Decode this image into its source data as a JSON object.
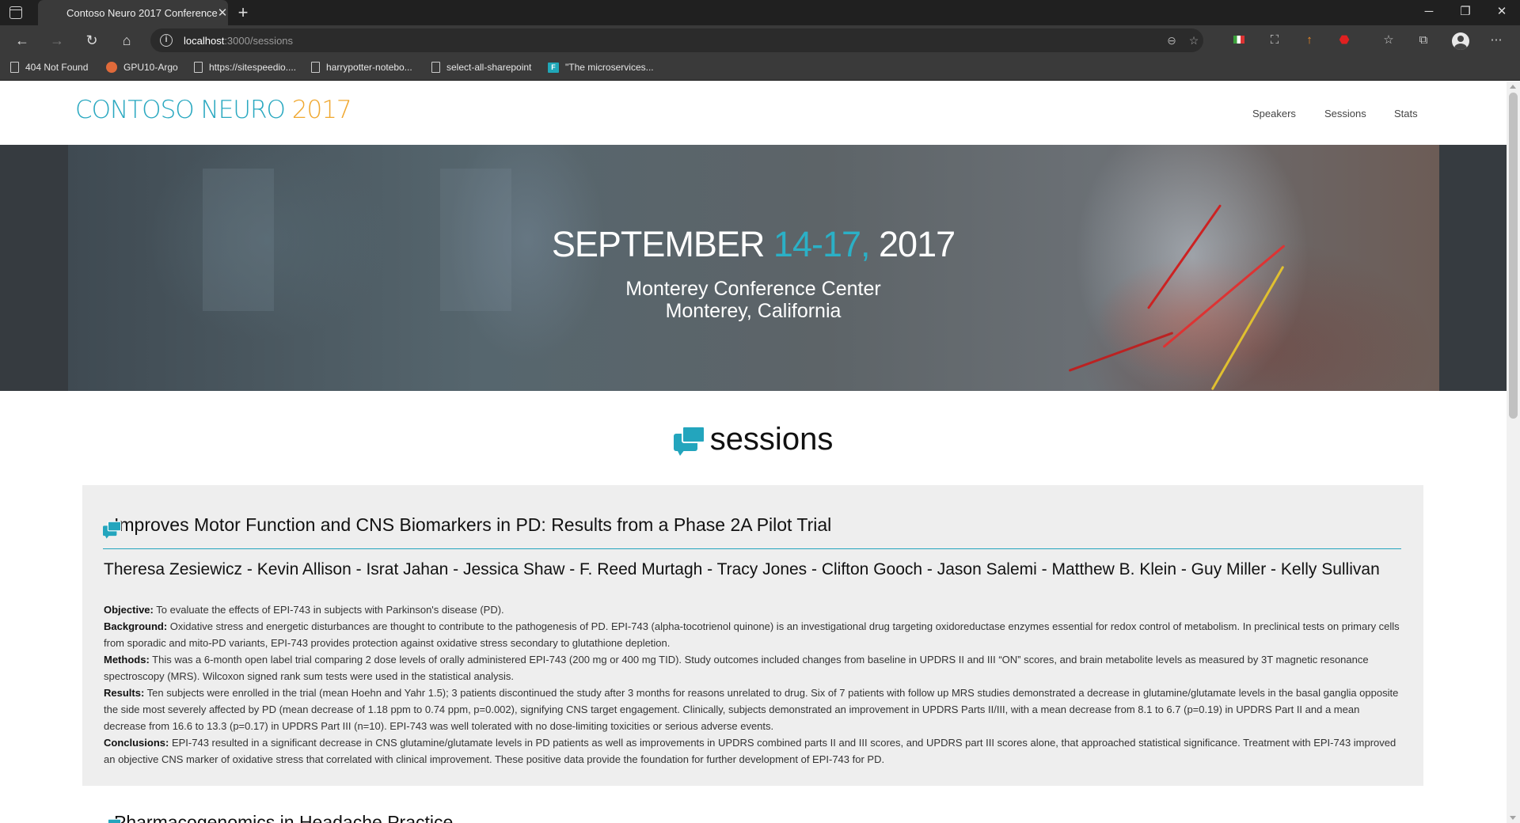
{
  "browser": {
    "tab_title": "Contoso Neuro 2017 Conference",
    "address_host": "localhost",
    "address_path": ":3000/sessions",
    "bookmarks": [
      {
        "label": "404 Not Found",
        "icon": "page-icon"
      },
      {
        "label": "GPU10-Argo",
        "icon": "argo-icon"
      },
      {
        "label": "https://sitespeedio....",
        "icon": "page-icon"
      },
      {
        "label": "harrypotter-notebo...",
        "icon": "page-icon"
      },
      {
        "label": "select-all-sharepoint",
        "icon": "page-icon"
      },
      {
        "label": "\"The microservices...",
        "icon": "microservices-icon"
      }
    ]
  },
  "site": {
    "logo_main": "CONTOSO NEURO ",
    "logo_year": "2017",
    "nav": [
      "Speakers",
      "Sessions",
      "Stats"
    ]
  },
  "hero": {
    "date_prefix": "SEPTEMBER ",
    "date_accent": "14-17, ",
    "date_year": "2017",
    "venue_line1": "Monterey Conference Center",
    "venue_line2": "Monterey, California"
  },
  "sessions": {
    "heading": "sessions",
    "items": [
      {
        "title": "Improves Motor Function and CNS Biomarkers in PD: Results from a Phase 2A Pilot Trial",
        "authors": "Theresa Zesiewicz - Kevin Allison - Israt Jahan - Jessica Shaw - F. Reed Murtagh - Tracy Jones - Clifton Gooch - Jason Salemi - Matthew B. Klein - Guy Miller - Kelly Sullivan",
        "abstract": [
          {
            "label": "Objective:",
            "text": " To evaluate the effects of EPI-743 in subjects with Parkinson's disease (PD)."
          },
          {
            "label": "Background:",
            "text": " Oxidative stress and energetic disturbances are thought to contribute to the pathogenesis of PD. EPI-743 (alpha-tocotrienol quinone) is an investigational drug targeting oxidoreductase enzymes essential for redox control of metabolism. In preclinical tests on primary cells from sporadic and mito-PD variants, EPI-743 provides protection against oxidative stress secondary to glutathione depletion."
          },
          {
            "label": "Methods:",
            "text": " This was a 6-month open label trial comparing 2 dose levels of orally administered EPI-743 (200 mg or 400 mg TID). Study outcomes included changes from baseline in UPDRS II and III “ON” scores, and brain metabolite levels as measured by 3T magnetic resonance spectroscopy (MRS). Wilcoxon signed rank sum tests were used in the statistical analysis."
          },
          {
            "label": "Results:",
            "text": " Ten subjects were enrolled in the trial (mean Hoehn and Yahr 1.5); 3 patients discontinued the study after 3 months for reasons unrelated to drug. Six of 7 patients with follow up MRS studies demonstrated a decrease in glutamine/glutamate levels in the basal ganglia opposite the side most severely affected by PD (mean decrease of 1.18 ppm to 0.74 ppm, p=0.002), signifying CNS target engagement. Clinically, subjects demonstrated an improvement in UPDRS Parts II/III, with a mean decrease from 8.1 to 6.7 (p=0.19) in UPDRS Part II and a mean decrease from 16.6 to 13.3 (p=0.17) in UPDRS Part III (n=10). EPI-743 was well tolerated with no dose-limiting toxicities or serious adverse events."
          },
          {
            "label": "Conclusions:",
            "text": " EPI-743 resulted in a significant decrease in CNS glutamine/glutamate levels in PD patients as well as improvements in UPDRS combined parts II and III scores, and UPDRS part III scores alone, that approached statistical significance. Treatment with EPI-743 improved an objective CNS marker of oxidative stress that correlated with clinical improvement. These positive data provide the foundation for further development of EPI-743 for PD."
          }
        ]
      },
      {
        "title": "Pharmacogenomics in Headache Practice"
      }
    ]
  },
  "colors": {
    "accent": "#23a5bd",
    "logo_year": "#f0a830",
    "card_bg": "#eeeeee"
  }
}
